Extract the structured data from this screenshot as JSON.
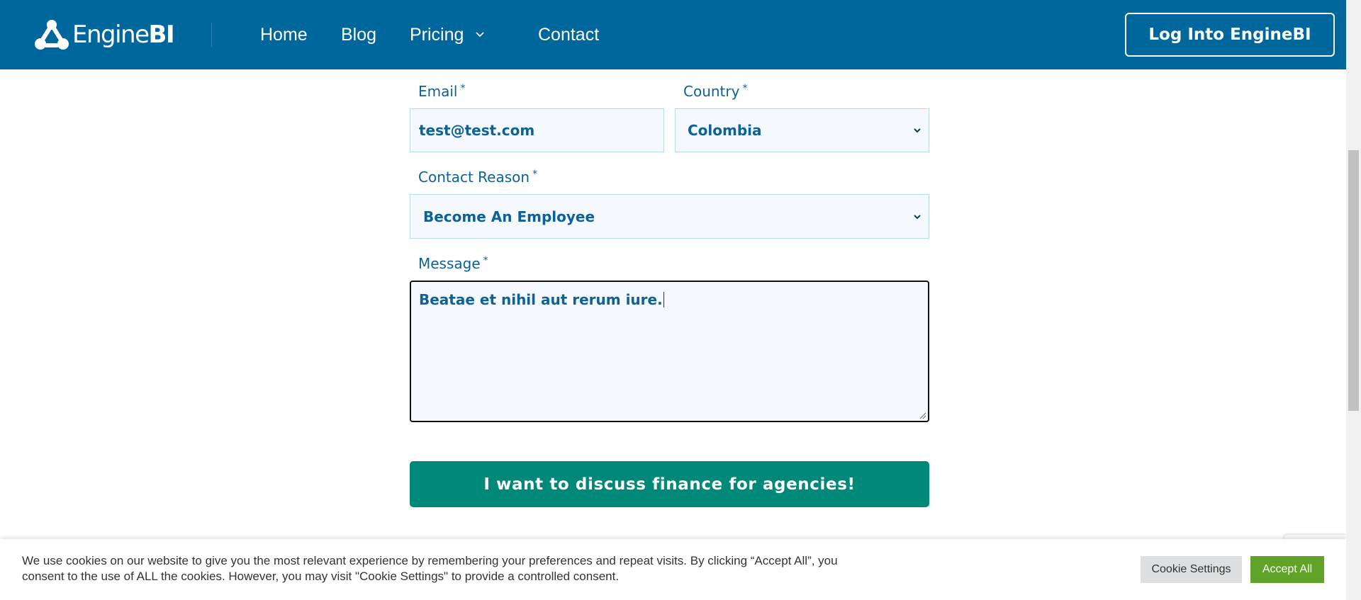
{
  "header": {
    "logo_text_light": "Engine",
    "logo_text_bold": "BI",
    "nav": {
      "home": "Home",
      "blog": "Blog",
      "pricing": "Pricing",
      "contact": "Contact"
    },
    "login_label": "Log Into EngineBI"
  },
  "form": {
    "email": {
      "label": "Email",
      "required_mark": "*",
      "value": "test@test.com"
    },
    "country": {
      "label": "Country",
      "required_mark": "*",
      "selected": "Colombia"
    },
    "contact_reason": {
      "label": "Contact Reason",
      "required_mark": "*",
      "selected": "Become An Employee"
    },
    "message": {
      "label": "Message",
      "required_mark": "*",
      "value": "Beatae et nihil aut rerum iure."
    },
    "submit_label": "I want to discuss finance for agencies!"
  },
  "cookie_banner": {
    "text_line1": "We use cookies on our website to give you the most relevant experience by remembering your preferences and repeat visits. By clicking “Accept All”, you",
    "text_line2": "consent to the use of ALL the cookies. However, you may visit \"Cookie Settings\" to provide a controlled consent.",
    "settings_label": "Cookie Settings",
    "accept_label": "Accept All"
  },
  "colors": {
    "header_bg": "#00679c",
    "text_blue": "#0c6296",
    "submit_bg": "#008878",
    "accept_bg": "#61a229"
  }
}
